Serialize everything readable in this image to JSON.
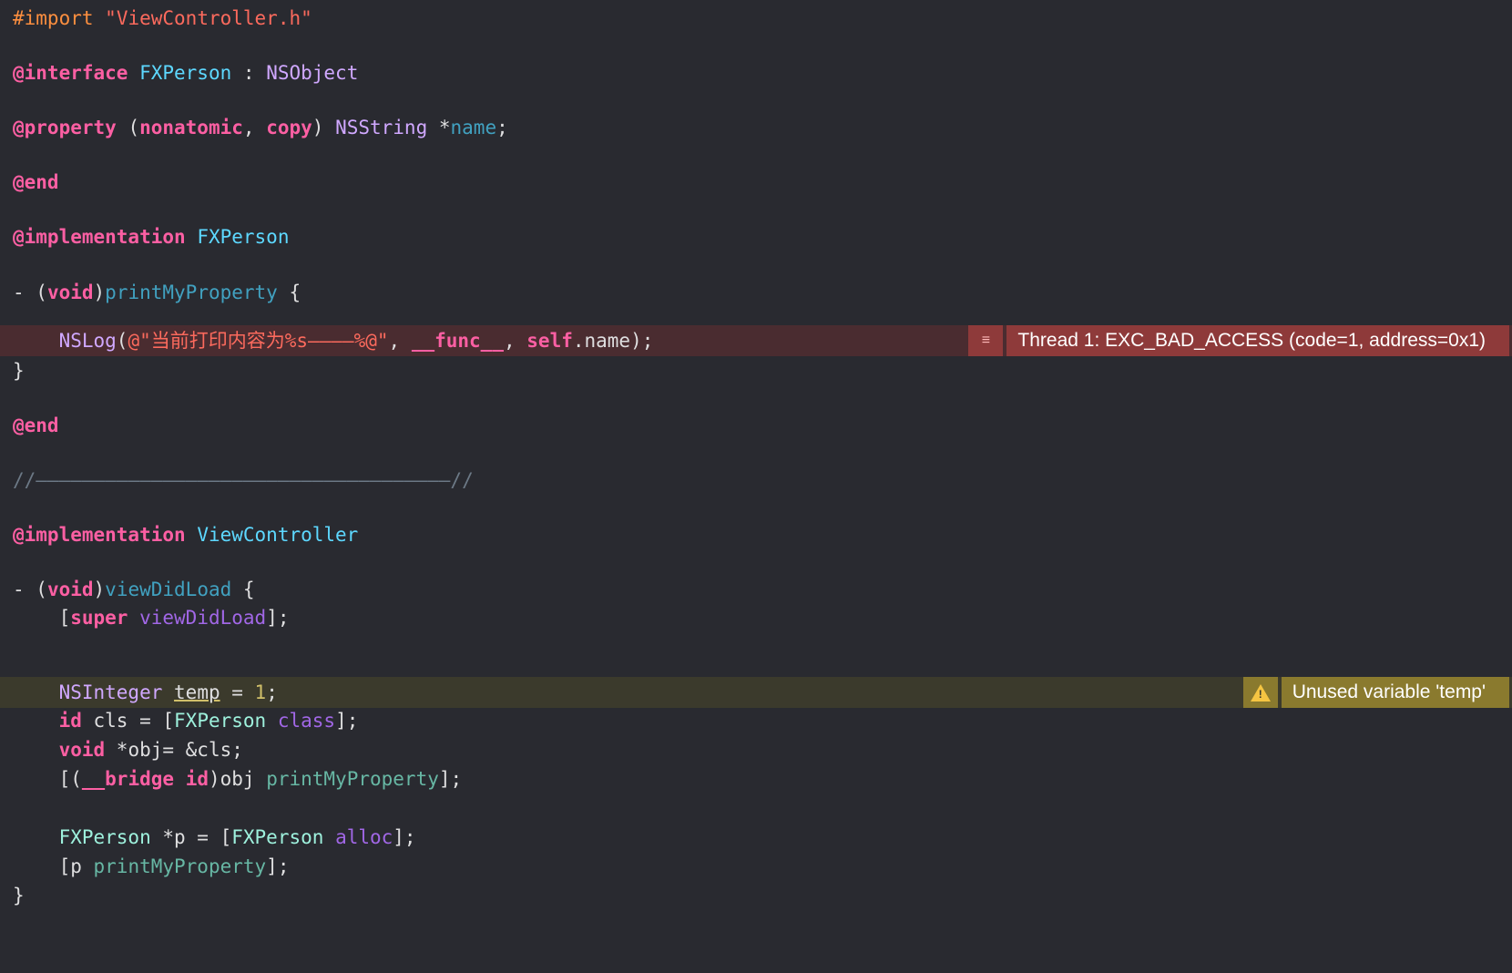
{
  "colors": {
    "background": "#292a30",
    "keyword": "#fc5fa3",
    "preprocessor": "#fd8f3f",
    "string": "#fc6a5d",
    "number": "#d0bf69",
    "comment": "#6c7986",
    "class_name": "#5dd8ff",
    "error_banner": "#8e3a3a",
    "warning_banner": "#8a7a2e"
  },
  "code": {
    "import_kw": "#import",
    "import_file": "\"ViewController.h\"",
    "interface_kw": "@interface",
    "class_fxperson": "FXPerson",
    "colon": " : ",
    "nsobject": "NSObject",
    "property_kw": "@property",
    "prop_open": " (",
    "nonatomic": "nonatomic",
    "comma": ", ",
    "copy": "copy",
    "prop_close": ") ",
    "nsstring": "NSString",
    "star": " *",
    "name_var": "name",
    "semicolon": ";",
    "end_kw": "@end",
    "implementation_kw": "@implementation",
    "method_dash": "- (",
    "void_kw": "void",
    "paren_close": ")",
    "print_method": "printMyProperty",
    "brace_open": " {",
    "nslog": "NSLog",
    "nslog_open": "(",
    "log_string": "@\"当前打印内容为%s————%@\"",
    "func_macro": "__func__",
    "self_kw": "self",
    "dot_name": ".name);",
    "brace_close": "}",
    "separator_comment": "//————————————————————————————————————//",
    "viewcontroller": "ViewController",
    "viewdidload": "viewDidLoad",
    "super_open": "[",
    "super_kw": "super",
    "super_close": "];",
    "nsinteger": "NSInteger",
    "temp_var": "temp",
    "assign": " = ",
    "one": "1",
    "id_kw": "id",
    "cls_decl": " cls = [",
    "class_msg": "class",
    "obj_decl": " *obj= &cls;",
    "bridge_open": "[(",
    "bridge_kw": "__bridge",
    "space": " ",
    "bridge_close": ")obj ",
    "fxperson_p": " *p = [",
    "alloc_msg": "alloc",
    "p_open": "[p ",
    "indent": "    "
  },
  "annotations": {
    "error": {
      "icon": "list-icon",
      "glyph": "≡",
      "message": "Thread 1: EXC_BAD_ACCESS (code=1, address=0x1)"
    },
    "warning": {
      "icon": "warning-triangle-icon",
      "glyph": "!",
      "message": "Unused variable 'temp'"
    }
  }
}
